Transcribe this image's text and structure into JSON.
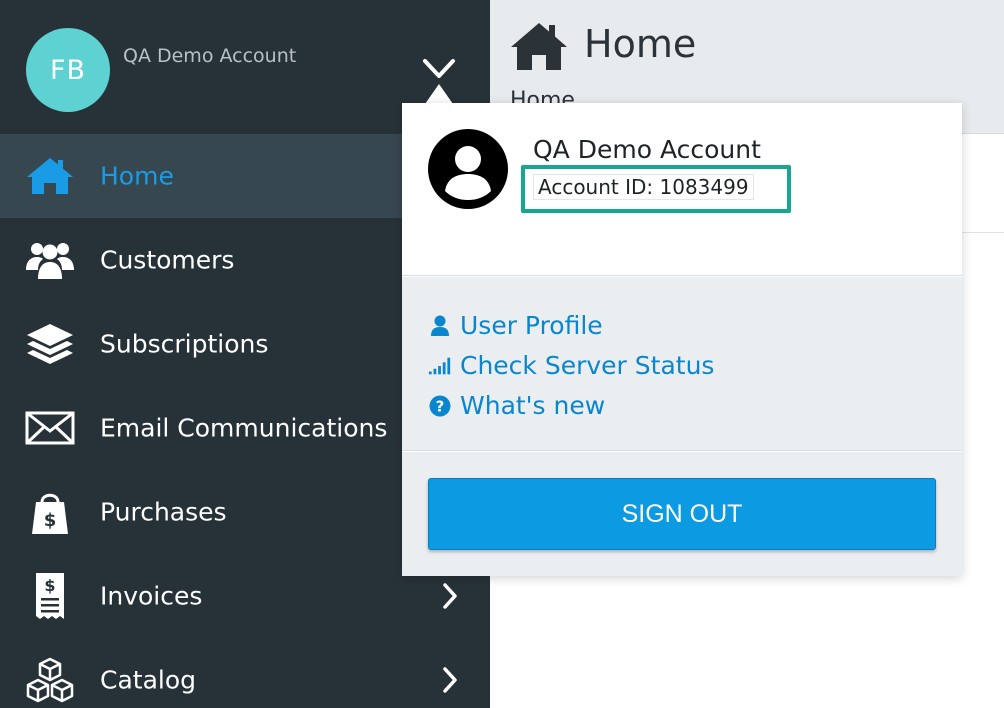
{
  "sidebar": {
    "avatar_initials": "FB",
    "account_name": "QA Demo Account",
    "toggle_icon": "chevron-down-icon",
    "items": [
      {
        "label": "Home",
        "icon": "home-icon",
        "active": true,
        "has_submenu": false
      },
      {
        "label": "Customers",
        "icon": "users-icon",
        "active": false,
        "has_submenu": false
      },
      {
        "label": "Subscriptions",
        "icon": "layers-icon",
        "active": false,
        "has_submenu": false
      },
      {
        "label": "Email Communications",
        "icon": "envelope-icon",
        "active": false,
        "has_submenu": false
      },
      {
        "label": "Purchases",
        "icon": "shopping-bag-icon",
        "active": false,
        "has_submenu": false
      },
      {
        "label": "Invoices",
        "icon": "receipt-icon",
        "active": false,
        "has_submenu": true
      },
      {
        "label": "Catalog",
        "icon": "cubes-icon",
        "active": false,
        "has_submenu": true
      }
    ]
  },
  "header": {
    "title": "Home",
    "breadcrumb": "Home",
    "icon": "home-icon"
  },
  "popover": {
    "account_name": "QA Demo Account",
    "account_id": "Account ID: 1083499",
    "links": [
      {
        "label": "User Profile",
        "icon": "user-icon"
      },
      {
        "label": "Check Server Status",
        "icon": "signal-icon"
      },
      {
        "label": "What's new",
        "icon": "question-circle-icon"
      }
    ],
    "signout_label": "SIGN OUT"
  },
  "colors": {
    "sidebar_bg": "#273238",
    "active_item_bg": "#37474f",
    "accent_blue": "#1a9be6",
    "avatar_teal": "#5ed2d2",
    "highlight_green": "#17a68f",
    "signout_blue": "#0c9be3",
    "link_blue": "#0a86cf"
  }
}
